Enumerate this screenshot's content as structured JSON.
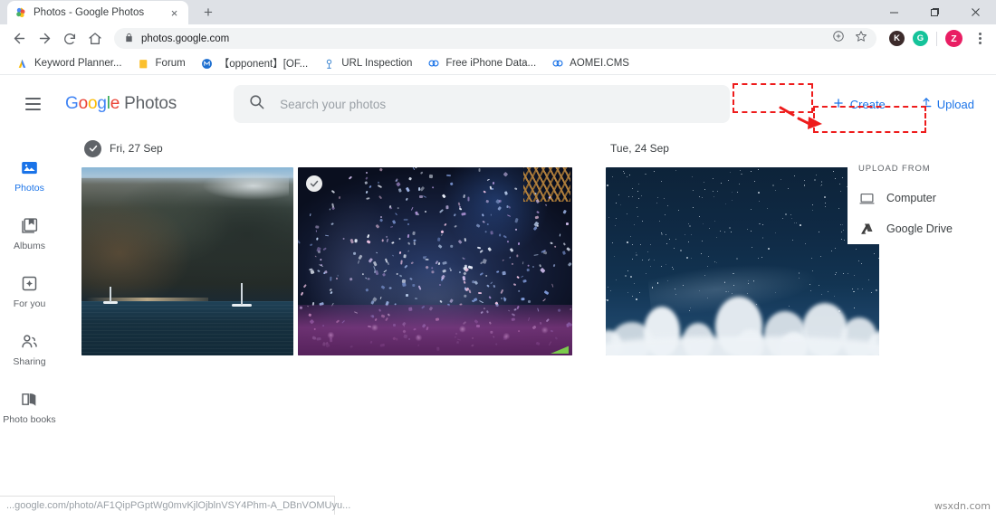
{
  "browser": {
    "tab": {
      "title": "Photos - Google Photos",
      "favicon": "google-photos-favicon",
      "close": "×"
    },
    "newtab_label": "+",
    "window_controls": {
      "minimize": "–",
      "maximize": "❐",
      "close": "✕"
    },
    "nav": {
      "back": "←",
      "forward": "→",
      "reload": "↻",
      "home": "⌂"
    },
    "omnibox": {
      "lock_icon": "lock-icon",
      "url": "photos.google.com",
      "install_icon": "install-icon",
      "bookmark_icon": "star-icon"
    },
    "extensions": [
      {
        "name": "extension-k",
        "letter": "K",
        "color": "#3c2b2b"
      },
      {
        "name": "grammarly-extension",
        "letter": "G",
        "color": "#15c39a"
      }
    ],
    "profile": {
      "letter": "Z",
      "color": "#e91e63"
    },
    "menu_icon": "kebab-menu-icon",
    "bookmarks": [
      {
        "label": "Keyword Planner...",
        "icon": "google-ads-icon"
      },
      {
        "label": "Forum",
        "icon": "folder-icon"
      },
      {
        "label": "【opponent】[OF...",
        "icon": "blue-circle-m-icon"
      },
      {
        "label": "URL Inspection",
        "icon": "search-console-icon"
      },
      {
        "label": "Free iPhone Data...",
        "icon": "link-icon"
      },
      {
        "label": "AOMEI.CMS",
        "icon": "link-icon"
      }
    ]
  },
  "app": {
    "menu_icon": "hamburger-menu-icon",
    "logo": {
      "g": "G",
      "o1": "o",
      "o2": "o",
      "g2": "g",
      "l": "l",
      "e": "e",
      "product": "Photos"
    },
    "search": {
      "icon": "search-icon",
      "placeholder": "Search your photos"
    },
    "create_button": {
      "label": "Create",
      "icon": "plus-icon"
    },
    "upload_button": {
      "label": "Upload",
      "icon": "upload-icon"
    },
    "upload_menu": {
      "title": "UPLOAD FROM",
      "items": [
        {
          "label": "Computer",
          "icon": "computer-icon"
        },
        {
          "label": "Google Drive",
          "icon": "google-drive-icon"
        }
      ]
    },
    "sidebar": [
      {
        "label": "Photos",
        "icon": "photos-icon",
        "active": true
      },
      {
        "label": "Albums",
        "icon": "albums-icon",
        "active": false
      },
      {
        "label": "For you",
        "icon": "for-you-icon",
        "active": false
      },
      {
        "label": "Sharing",
        "icon": "sharing-icon",
        "active": false
      },
      {
        "label": "Photo books",
        "icon": "photo-books-icon",
        "active": false
      }
    ],
    "sections": [
      {
        "date": "Fri, 27 Sep",
        "has_select_all": true,
        "select_all_icon": "checkmark-circle-icon",
        "photos": [
          {
            "name": "photo-napali-cliffs",
            "selected": false
          },
          {
            "name": "photo-concert-confetti",
            "selected": true,
            "select_icon": "checkmark-circle-icon"
          }
        ]
      },
      {
        "date": "Tue, 24 Sep",
        "has_select_all": false,
        "photos": [
          {
            "name": "photo-night-sky-clouds",
            "selected": false
          }
        ]
      }
    ],
    "status_url": "...google.com/photo/AF1QipPGptWg0mvKjlOjblnVSY4Phm-A_DBnVOMUyu...",
    "watermark": "wsxdn.com"
  },
  "annotations": {
    "color": "#ee1c1c",
    "boxes": [
      {
        "name": "upload-button-highlight"
      },
      {
        "name": "computer-menu-item-highlight"
      }
    ],
    "arrow": {
      "name": "upload-to-computer-arrow"
    }
  }
}
